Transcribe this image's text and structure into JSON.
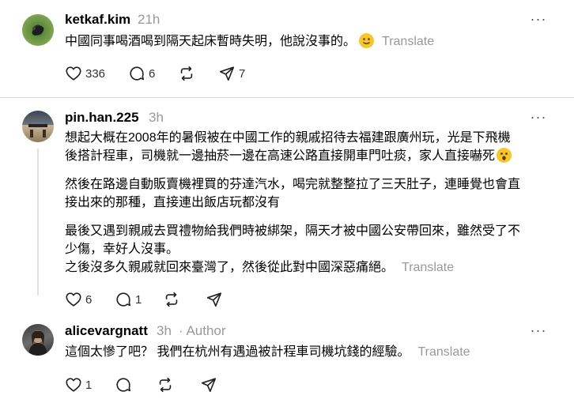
{
  "posts": [
    {
      "username": "ketkaf.kim",
      "time": "21h",
      "lines": [
        "中國同事喝酒喝到隔天起床暫時失明，他說沒事的。"
      ],
      "translate": "Translate",
      "likes": "336",
      "replies": "6",
      "reposts": "",
      "shares": "7"
    },
    {
      "username": "pin.han.225",
      "time": "3h",
      "lines": [
        "想起大概在2008年的暑假被在中國工作的親戚招待去福建跟廣州玩，光是下飛機",
        "後搭計程車，司機就一邊抽菸一邊在高速公路直接開車門吐痰，家人直接嚇死",
        "然後在路邊自動販賣機裡買的芬達汽水，喝完就整整拉了三天肚子，連睡覺也會直",
        "接出來的那種，直接連出飯店玩都沒有",
        "最後又遇到親戚去買禮物給我們時被綁架，隔天才被中國公安帶回來，雖然受了不",
        "少傷，幸好人沒事。",
        "之後沒多久親戚就回來臺灣了，然後從此對中國深惡痛絕。"
      ],
      "translate": "Translate",
      "likes": "6",
      "replies": "1",
      "reposts": "",
      "shares": ""
    },
    {
      "username": "alicevargnatt",
      "time": "3h",
      "author_label": "· Author",
      "lines": [
        "這個太慘了吧？ 我們在杭州有遇過被計程車司機坑錢的經驗。"
      ],
      "translate": "Translate",
      "likes": "1",
      "replies": "",
      "reposts": "",
      "shares": ""
    }
  ],
  "icons": {
    "more": "more-dots-icon",
    "like": "heart-icon",
    "reply": "comment-icon",
    "repost": "repost-icon",
    "share": "send-icon"
  },
  "colors": {
    "muted": "#999999",
    "divider": "#dcdcdc",
    "emoji": "#f7c52e"
  }
}
